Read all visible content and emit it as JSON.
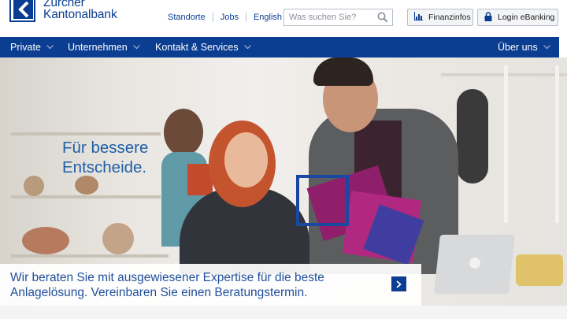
{
  "brand": {
    "line1": "Zürcher",
    "line2": "Kantonalbank",
    "color": "#0a3d91"
  },
  "toplinks": [
    "Standorte",
    "Jobs",
    "English"
  ],
  "search": {
    "placeholder": "Was suchen Sie?",
    "icon": "search-icon"
  },
  "buttons": {
    "finanzinfos": {
      "label": "Finanzinfos",
      "icon": "bar-chart-icon"
    },
    "login": {
      "label": "Login eBanking",
      "icon": "lock-icon"
    }
  },
  "nav": {
    "items": [
      "Private",
      "Unternehmen",
      "Kontakt & Services"
    ],
    "right": "Über uns",
    "background": "#0b3d91"
  },
  "hero": {
    "heading_line1": "Für bessere",
    "heading_line2": "Entscheide.",
    "banner_line1": "Wir beraten Sie mit ausgewiesener Expertise für die beste",
    "banner_line2": "Anlagelösung. Vereinbaren Sie einen Beratungstermin.",
    "banner_icon": "chevron-right-icon"
  }
}
